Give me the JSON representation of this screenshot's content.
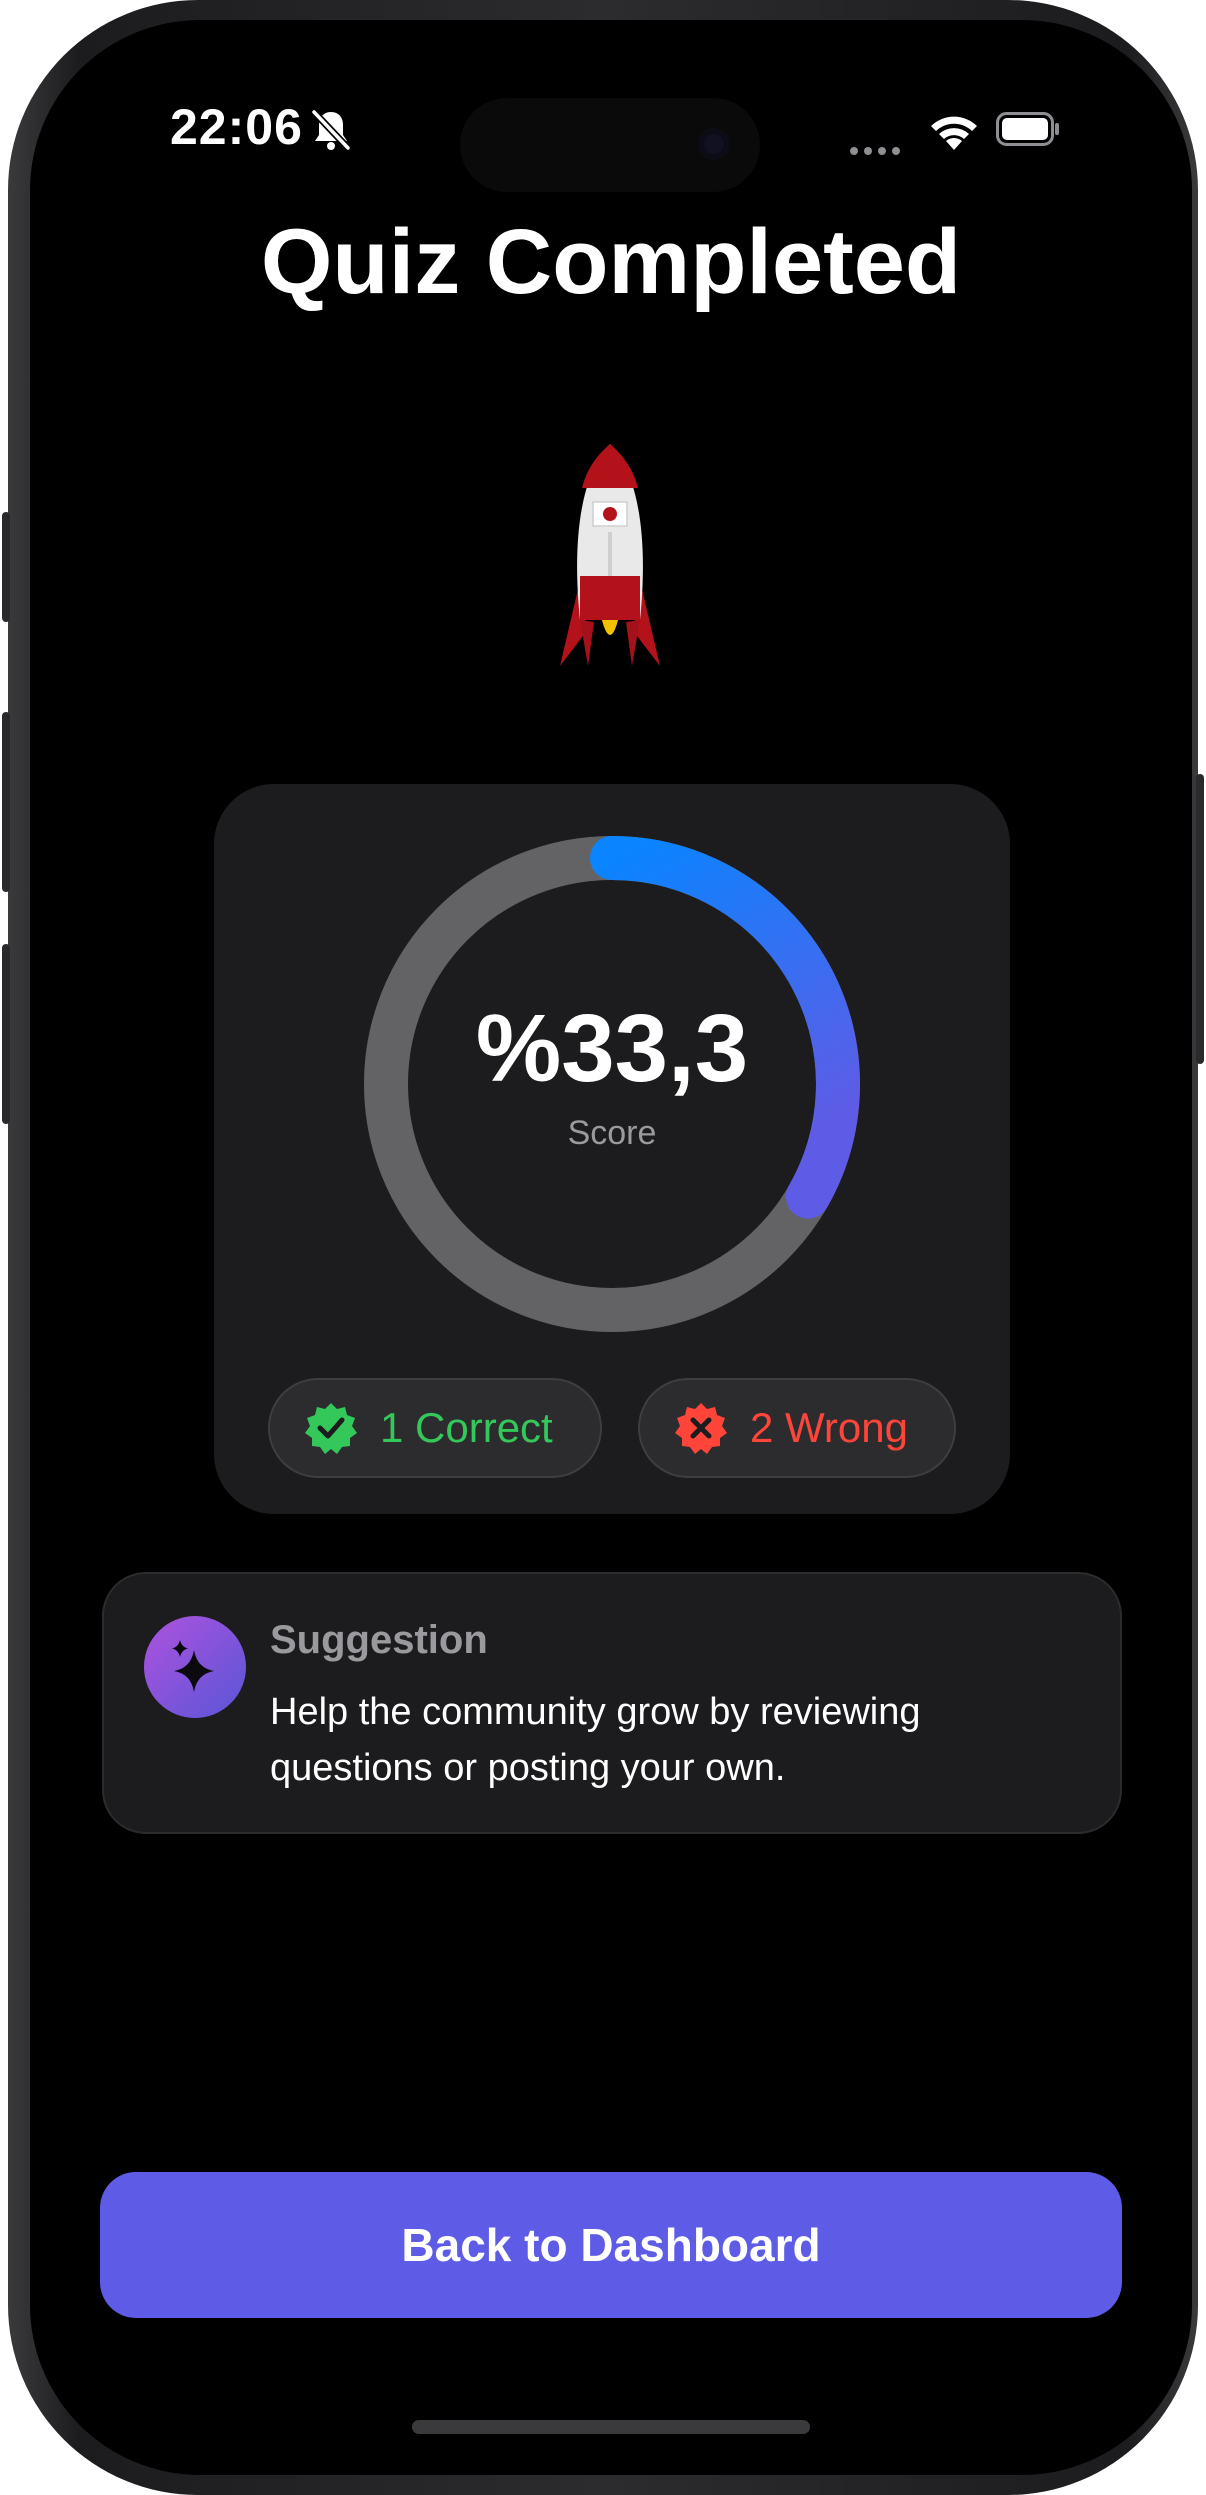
{
  "status_bar": {
    "time": "22:06",
    "icons": [
      "bell-slash-icon",
      "cellular-dots-icon",
      "wifi-icon",
      "battery-icon"
    ]
  },
  "page": {
    "title": "Quiz Completed",
    "illustration": "rocket-icon"
  },
  "score": {
    "value_text": "%33,3",
    "label": "Score",
    "progress_fraction": 0.333,
    "colors": {
      "track": "#636366",
      "start": "#0a84ff",
      "end": "#5e5ce6"
    }
  },
  "results": {
    "correct_label": "1 Correct",
    "correct_icon": "checkmark-seal-icon",
    "correct_color": "#34c759",
    "wrong_label": "2 Wrong",
    "wrong_icon": "xmark-seal-icon",
    "wrong_color": "#ff453a"
  },
  "suggestion": {
    "icon": "sparkles-icon",
    "title": "Suggestion",
    "body": "Help the community grow by reviewing questions or posting your own."
  },
  "actions": {
    "back_label": "Back to Dashboard",
    "accent_color": "#5e5ce6"
  }
}
